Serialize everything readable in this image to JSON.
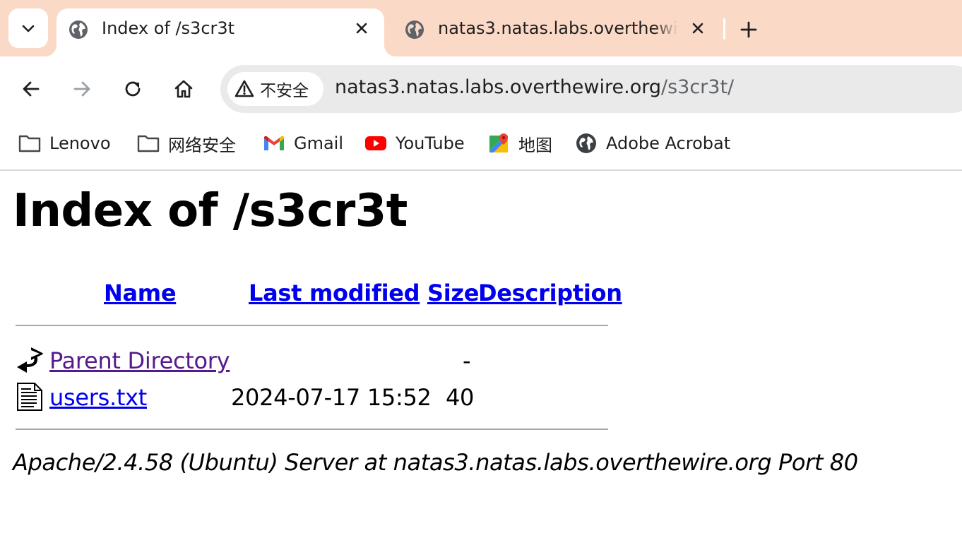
{
  "tabs": [
    {
      "title": "Index of /s3cr3t",
      "active": true,
      "favicon": "globe-icon"
    },
    {
      "title": "natas3.natas.labs.overthewire.org",
      "active": false,
      "favicon": "globe-icon"
    }
  ],
  "toolbar": {
    "security_label": "不安全",
    "url_host": "natas3.natas.labs.overthewire.org",
    "url_path": "/s3cr3t/"
  },
  "bookmarks": [
    {
      "label": "Lenovo",
      "icon": "folder-icon"
    },
    {
      "label": "网络安全",
      "icon": "folder-icon"
    },
    {
      "label": "Gmail",
      "icon": "gmail-icon"
    },
    {
      "label": "YouTube",
      "icon": "youtube-icon"
    },
    {
      "label": "地图",
      "icon": "maps-icon"
    },
    {
      "label": "Adobe Acrobat",
      "icon": "globe-icon"
    }
  ],
  "page": {
    "title": "Index of /s3cr3t",
    "columns": {
      "name": "Name",
      "last_modified": "Last modified",
      "size": "Size",
      "description": "Description"
    },
    "rows": [
      {
        "name": "Parent Directory",
        "last_modified": "",
        "size": "-",
        "description": "",
        "icon": "parent-directory-icon"
      },
      {
        "name": "users.txt",
        "last_modified": "2024-07-17 15:52",
        "size": "40",
        "description": "",
        "icon": "text-file-icon"
      }
    ],
    "address": "Apache/2.4.58 (Ubuntu) Server at natas3.natas.labs.overthewire.org Port 80"
  },
  "colors": {
    "tabstrip": "#fbd9c7",
    "link": "#0000ee",
    "visited_link": "#551a8b"
  }
}
